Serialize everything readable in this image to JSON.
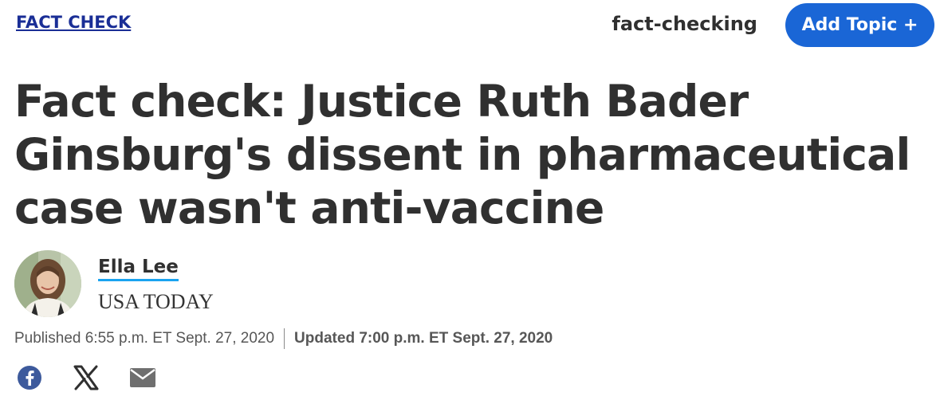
{
  "header": {
    "section_label": "FACT CHECK",
    "topic_label": "fact-checking",
    "add_topic_label": "Add Topic +"
  },
  "article": {
    "headline": "Fact check: Justice Ruth Bader Ginsburg's dissent in pharmaceutical case wasn't anti-vaccine",
    "author": {
      "name": "Ella Lee",
      "organization": "USA TODAY"
    },
    "published": "Published 6:55 p.m. ET Sept. 27, 2020",
    "updated": "Updated 7:00 p.m. ET Sept. 27, 2020"
  },
  "share": {
    "icons": [
      "facebook-icon",
      "x-icon",
      "email-icon"
    ]
  },
  "colors": {
    "section_link": "#1a2e96",
    "button_bg": "#1a66d6",
    "author_underline": "#1aa3f0",
    "text": "#303030",
    "meta_text": "#575757"
  }
}
